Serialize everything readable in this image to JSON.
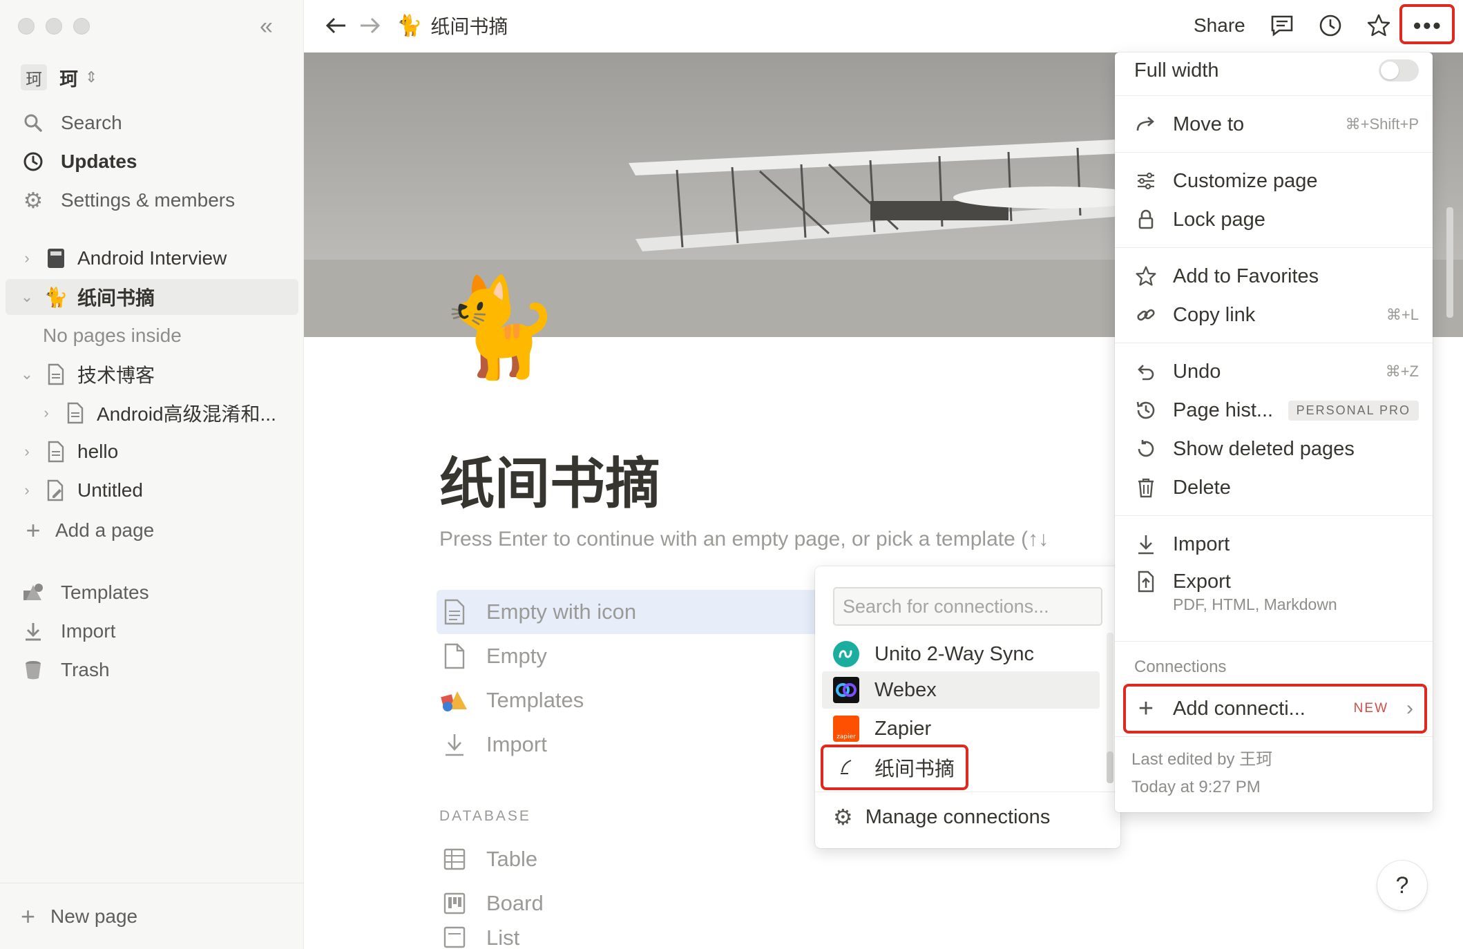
{
  "sidebar": {
    "workspace": {
      "avatar": "珂",
      "name": "珂"
    },
    "nav": {
      "search": "Search",
      "updates": "Updates",
      "settings": "Settings & members"
    },
    "tree": {
      "android_interview": "Android Interview",
      "zhijian": "纸间书摘",
      "no_pages": "No pages inside",
      "tech_blog": "技术博客",
      "android_advanced": "Android高级混淆和...",
      "hello": "hello",
      "untitled": "Untitled",
      "add_page": "Add a page"
    },
    "bottom": {
      "templates": "Templates",
      "import": "Import",
      "trash": "Trash",
      "new_page": "New page"
    }
  },
  "topbar": {
    "page_emoji": "🐈",
    "page_title": "纸间书摘",
    "share": "Share"
  },
  "page": {
    "icon": "🐈",
    "title": "纸间书摘",
    "hint": "Press Enter to continue with an empty page, or pick a template (↑↓",
    "templates": {
      "empty_with_icon": "Empty with icon",
      "empty": "Empty",
      "templates": "Templates",
      "import": "Import"
    },
    "database_label": "DATABASE",
    "database": {
      "table": "Table",
      "board": "Board",
      "list": "List"
    }
  },
  "connections_popup": {
    "search_placeholder": "Search for connections...",
    "items": {
      "unito": "Unito 2-Way Sync",
      "webex": "Webex",
      "zapier": "Zapier",
      "zhijian": "纸间书摘"
    },
    "zapier_logo_text": "zapier",
    "manage": "Manage connections"
  },
  "menu": {
    "full_width": "Full width",
    "move_to": "Move to",
    "move_to_shortcut": "⌘+Shift+P",
    "customize": "Customize page",
    "lock": "Lock page",
    "favorites": "Add to Favorites",
    "copy_link": "Copy link",
    "copy_link_shortcut": "⌘+L",
    "undo": "Undo",
    "undo_shortcut": "⌘+Z",
    "page_history": "Page hist...",
    "page_history_badge": "PERSONAL PRO",
    "show_deleted": "Show deleted pages",
    "delete": "Delete",
    "import": "Import",
    "export": "Export",
    "export_sub": "PDF, HTML, Markdown",
    "connections_heading": "Connections",
    "add_connection": "Add connecti...",
    "add_connection_badge": "NEW",
    "last_edited": "Last edited by 王珂",
    "edited_time": "Today at 9:27 PM"
  },
  "help": "?"
}
